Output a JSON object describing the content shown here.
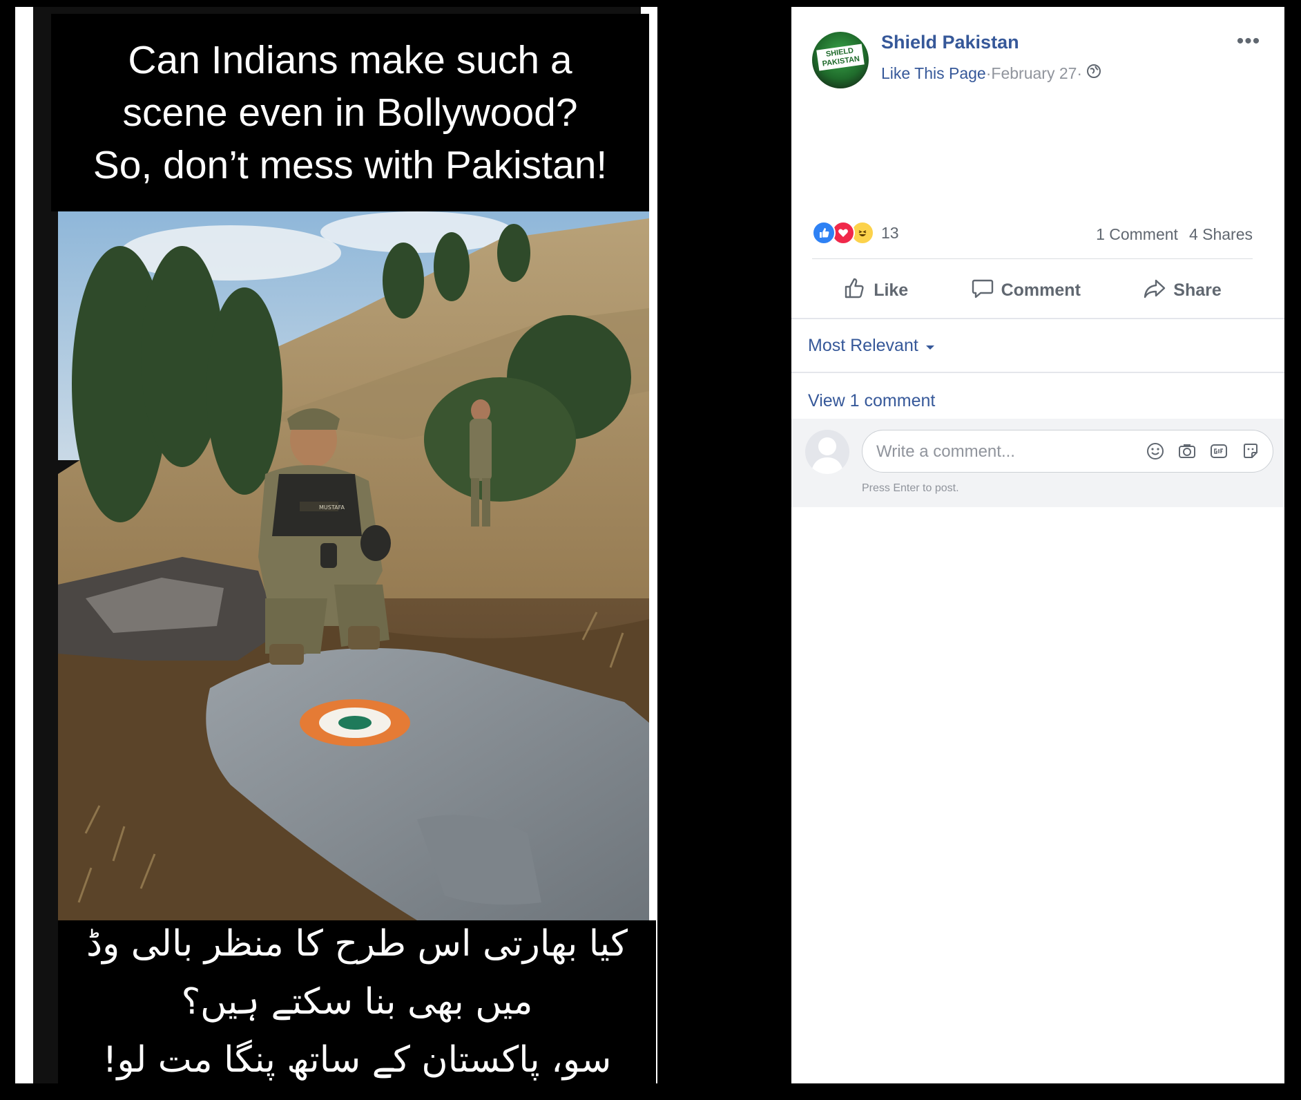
{
  "image_post": {
    "caption_top_lines": [
      "Can Indians make such a",
      "scene even in Bollywood?",
      "So, don’t mess with Pakistan!"
    ],
    "caption_bottom_lines": [
      "کیا بھارتی اس طرح کا منظر بالی وڈ میں بھی بنا سکتے ہیں؟",
      "سو، پاکستان کے ساتھ پنگا مت لو!"
    ],
    "name_tag": "MUSTAFA"
  },
  "sidebar": {
    "page_name": "Shield Pakistan",
    "avatar_text": "SHIELD PAKISTAN",
    "like_page_label": "Like This Page",
    "separator": " · ",
    "date": "February 27",
    "more_label": "•••",
    "reaction_count": "13",
    "comment_count": "1 Comment",
    "share_count": "4 Shares",
    "actions": {
      "like": "Like",
      "comment": "Comment",
      "share": "Share"
    },
    "sort_label": "Most Relevant",
    "view_comments_label": "View 1 comment",
    "comment_placeholder": "Write a comment...",
    "post_hint": "Press Enter to post."
  },
  "colors": {
    "link_blue": "#365899",
    "muted_text": "#90949c",
    "like_blue": "#2e81f4",
    "love_red": "#f0284a",
    "haha_yellow": "#fcd24b"
  },
  "icons": [
    "globe-icon",
    "more-icon",
    "thumbs-up-icon",
    "speech-bubble-icon",
    "share-arrow-icon",
    "caret-down-icon",
    "emoji-icon",
    "camera-icon",
    "gif-icon",
    "sticker-icon"
  ]
}
